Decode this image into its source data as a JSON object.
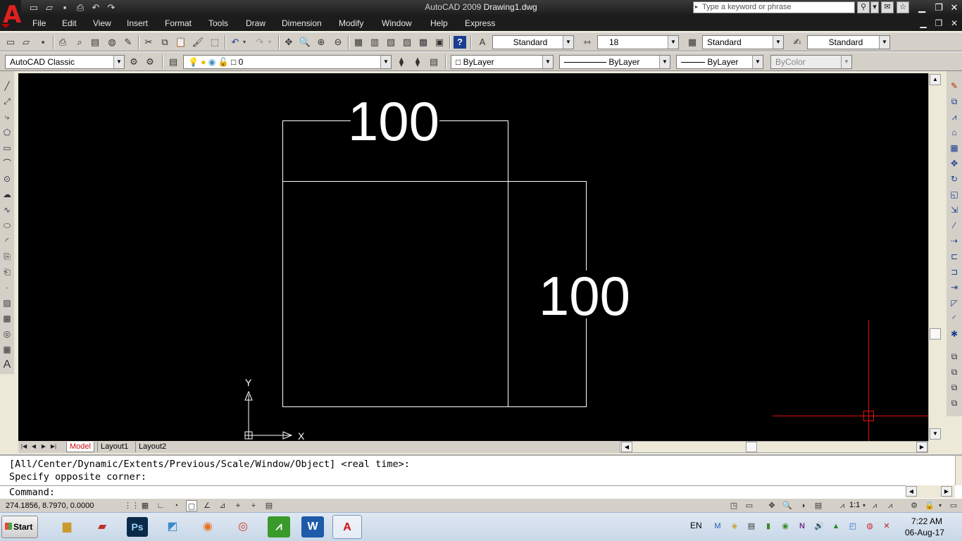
{
  "titlebar": {
    "app_name": "AutoCAD 2009",
    "document": "Drawing1.dwg",
    "search_placeholder": "Type a keyword or phrase"
  },
  "menu": [
    "File",
    "Edit",
    "View",
    "Insert",
    "Format",
    "Tools",
    "Draw",
    "Dimension",
    "Modify",
    "Window",
    "Help",
    "Express"
  ],
  "toolbar1": {
    "text_style": "Standard",
    "dim_style_value": "18",
    "table_style": "Standard",
    "multileader_style": "Standard"
  },
  "toolbar2": {
    "workspace": "AutoCAD Classic",
    "layer": "0",
    "color": "ByLayer",
    "linetype": "ByLayer",
    "lineweight": "ByLayer",
    "plot_style": "ByColor"
  },
  "drawing": {
    "dim_top": "100",
    "dim_right": "100",
    "ucs_x": "X",
    "ucs_y": "Y"
  },
  "layout_tabs": [
    "Model",
    "Layout1",
    "Layout2"
  ],
  "command": {
    "line1": "[All/Center/Dynamic/Extents/Previous/Scale/Window/Object] <real time>:",
    "line2": "Specify opposite corner:",
    "prompt": "Command:"
  },
  "status": {
    "coordinates": "274.1856, 8.7970, 0.0000",
    "annotation_scale": "1:1"
  },
  "taskbar": {
    "start_label": "Start",
    "language": "EN",
    "time": "7:22 AM",
    "date": "06-Aug-17"
  },
  "colors": {
    "title_bg": "#1c1c1c",
    "canvas_bg": "#000000",
    "crosshair": "#e01010",
    "active_tab": "#d01010"
  }
}
